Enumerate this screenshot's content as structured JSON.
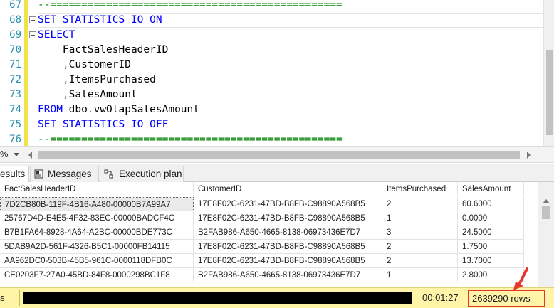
{
  "editor": {
    "lines": [
      {
        "num": "67",
        "tokens": [
          {
            "t": "--===============================================",
            "c": "cm"
          }
        ]
      },
      {
        "num": "68",
        "fold": true,
        "tokens": [
          {
            "t": "SET ",
            "c": "kw"
          },
          {
            "t": "STATISTICS ",
            "c": "kw"
          },
          {
            "t": "IO ",
            "c": "kw"
          },
          {
            "t": "ON",
            "c": "kw"
          }
        ]
      },
      {
        "num": "69",
        "fold": true,
        "tokens": [
          {
            "t": "SELECT",
            "c": "kw"
          }
        ]
      },
      {
        "num": "70",
        "tokens": [
          {
            "t": "    FactSalesHeaderID",
            "c": "id"
          }
        ]
      },
      {
        "num": "71",
        "tokens": [
          {
            "t": "    ",
            "c": "id"
          },
          {
            "t": ",",
            "c": "op"
          },
          {
            "t": "CustomerID",
            "c": "id"
          }
        ]
      },
      {
        "num": "72",
        "tokens": [
          {
            "t": "    ",
            "c": "id"
          },
          {
            "t": ",",
            "c": "op"
          },
          {
            "t": "ItemsPurchased",
            "c": "id"
          }
        ]
      },
      {
        "num": "73",
        "tokens": [
          {
            "t": "    ",
            "c": "id"
          },
          {
            "t": ",",
            "c": "op"
          },
          {
            "t": "SalesAmount",
            "c": "id"
          }
        ]
      },
      {
        "num": "74",
        "tokens": [
          {
            "t": "FROM ",
            "c": "kw"
          },
          {
            "t": "dbo",
            "c": "id"
          },
          {
            "t": ".",
            "c": "op"
          },
          {
            "t": "vwOlapSalesAmount",
            "c": "id"
          }
        ]
      },
      {
        "num": "75",
        "tokens": [
          {
            "t": "SET ",
            "c": "kw"
          },
          {
            "t": "STATISTICS ",
            "c": "kw"
          },
          {
            "t": "IO ",
            "c": "kw"
          },
          {
            "t": "OFF",
            "c": "kw"
          }
        ]
      },
      {
        "num": "76",
        "tokens": [
          {
            "t": "--===============================================",
            "c": "cm"
          }
        ]
      }
    ]
  },
  "zoom": {
    "value": "%"
  },
  "tabs": [
    {
      "label": "esults",
      "icon": "results-grid-icon",
      "active": true
    },
    {
      "label": "Messages",
      "icon": "messages-icon",
      "active": false
    },
    {
      "label": "Execution plan",
      "icon": "execution-plan-icon",
      "active": false
    }
  ],
  "grid": {
    "columns": [
      "FactSalesHeaderID",
      "CustomerID",
      "ItemsPurchased",
      "SalesAmount"
    ],
    "rows": [
      [
        "7D2CB80B-119F-4B16-A480-00000B7A99A7",
        "17E8F02C-6231-47BD-B8FB-C98890A568B5",
        "2",
        "60.6000"
      ],
      [
        "25767D4D-E4E5-4F32-83EC-00000BADCF4C",
        "17E8F02C-6231-47BD-B8FB-C98890A568B5",
        "1",
        "0.0000"
      ],
      [
        "B7B1FA64-8928-4A64-A2BC-00000BDE773C",
        "B2FAB986-A650-4665-8138-06973436E7D7",
        "3",
        "24.5000"
      ],
      [
        "5DAB9A2D-561F-4326-B5C1-00000FB14115",
        "17E8F02C-6231-47BD-B8FB-C98890A568B5",
        "2",
        "1.7500"
      ],
      [
        "AA962DC0-503B-45B5-961C-0000118DFB0C",
        "17E8F02C-6231-47BD-B8FB-C98890A568B5",
        "2",
        "13.7000"
      ],
      [
        "CE0203F7-27A0-45BD-84F8-0000298BC1F8",
        "B2FAB986-A650-4665-8138-06973436E7D7",
        "1",
        "2.8000"
      ]
    ]
  },
  "status": {
    "first": "s",
    "elapsed": "00:01:27",
    "rows": "2639290 rows"
  },
  "colors": {
    "keyword": "#0000ff",
    "comment": "#008000",
    "line_number": "#2b91af",
    "status_bg": "#fff4a8",
    "highlight": "#e8352e"
  }
}
